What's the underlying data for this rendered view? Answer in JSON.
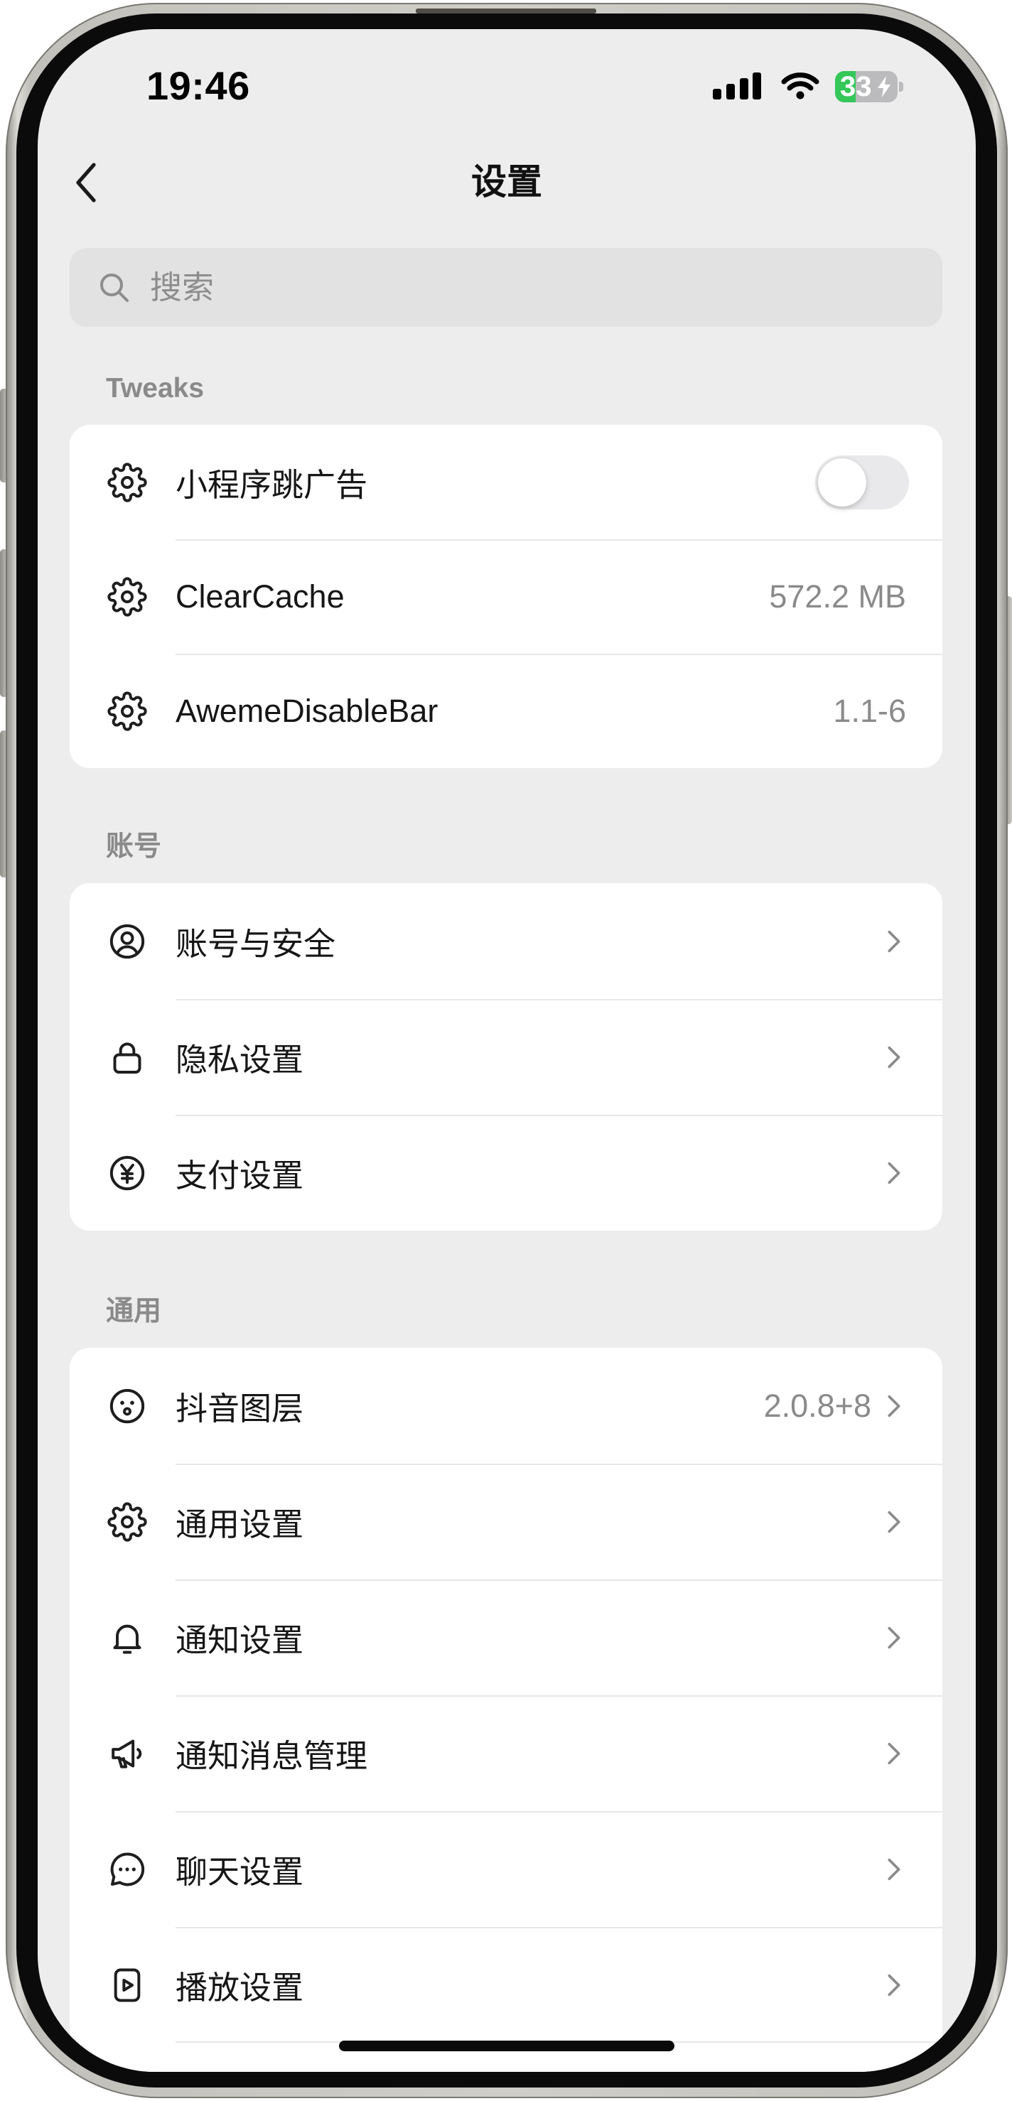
{
  "status_bar": {
    "time": "19:46",
    "battery_level": "33",
    "icons": [
      "cellular-signal-icon",
      "wifi-icon",
      "battery-charging-icon"
    ]
  },
  "nav": {
    "title": "设置",
    "back_icon": "chevron-left-icon"
  },
  "search": {
    "placeholder": "搜索",
    "value": "",
    "icon": "search-icon"
  },
  "sections": [
    {
      "header": "Tweaks",
      "rows": [
        {
          "icon": "gear-icon",
          "label": "小程序跳广告",
          "toggle_on": false
        },
        {
          "icon": "gear-icon",
          "label": "ClearCache",
          "value": "572.2 MB"
        },
        {
          "icon": "gear-icon",
          "label": "AwemeDisableBar",
          "value": "1.1-6"
        }
      ]
    },
    {
      "header": "账号",
      "rows": [
        {
          "icon": "user-circle-icon",
          "label": "账号与安全",
          "accessory_icon": "chevron-right-icon"
        },
        {
          "icon": "lock-icon",
          "label": "隐私设置",
          "accessory_icon": "chevron-right-icon"
        },
        {
          "icon": "yen-circle-icon",
          "label": "支付设置",
          "accessory_icon": "chevron-right-icon"
        }
      ]
    },
    {
      "header": "通用",
      "rows": [
        {
          "icon": "face-icon",
          "label": "抖音图层",
          "value": "2.0.8+8",
          "accessory_icon": "chevron-right-icon"
        },
        {
          "icon": "gear-icon",
          "label": "通用设置",
          "accessory_icon": "chevron-right-icon"
        },
        {
          "icon": "bell-icon",
          "label": "通知设置",
          "accessory_icon": "chevron-right-icon"
        },
        {
          "icon": "megaphone-icon",
          "label": "通知消息管理",
          "accessory_icon": "chevron-right-icon"
        },
        {
          "icon": "chat-bubble-icon",
          "label": "聊天设置",
          "accessory_icon": "chevron-right-icon"
        },
        {
          "icon": "play-square-icon",
          "label": "播放设置",
          "accessory_icon": "chevron-right-icon"
        }
      ]
    }
  ],
  "colors": {
    "screen_background": "#EDEDED",
    "card_background": "#FFFFFF",
    "section_header": "#8A8A8A",
    "secondary_text": "#8A8A8A",
    "battery_fill": "#34C759",
    "toggle_off_track": "#E9E9EB"
  }
}
